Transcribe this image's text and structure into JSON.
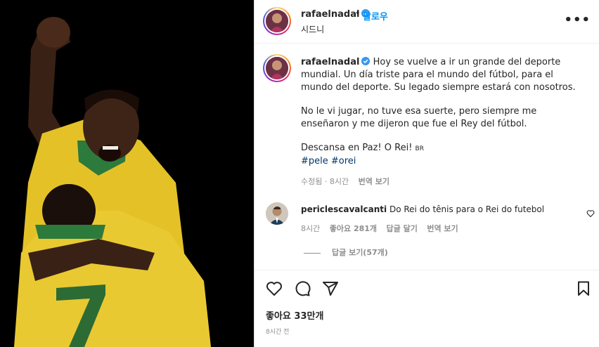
{
  "post": {
    "author": "rafaelnadal",
    "follow_label": "팔로우",
    "dot": "•",
    "location": "시드니",
    "more": "•••"
  },
  "caption": {
    "username": "rafaelnadal",
    "line1": "Hoy se vuelve a ir un grande del deporte mundial. Un día triste para el mundo del fútbol, para el mundo del deporte. Su legado siempre estará con nosotros.",
    "line2": "No le vi jugar, no tuve esa suerte, pero siempre me enseñaron y me dijeron que fue el Rey del fútbol.",
    "line3": "Descansa en Paz! O Rei!",
    "line3_tag": "BR",
    "hashtags": "#pele #orei",
    "edited": "수정됨",
    "time": "8시간",
    "translate": "번역 보기"
  },
  "comment": {
    "username": "periclescavalcanti",
    "text": "Do Rei do tênis para o Rei do futebol",
    "time": "8시간",
    "likes": "좋아요 281개",
    "reply": "답글 달기",
    "translate": "번역 보기",
    "view_replies": "답글 보기(57개)"
  },
  "footer": {
    "likes": "좋아요 33만개",
    "time": "8시간 전"
  },
  "icons": {
    "like": "heart-icon",
    "comment": "comment-icon",
    "share": "share-icon",
    "save": "bookmark-icon",
    "more": "more-icon",
    "verified": "verified-badge-icon"
  },
  "colors": {
    "accent": "#0095f6",
    "hashtag": "#00376b",
    "muted": "#8e8e8e",
    "verified": "#3897f0"
  }
}
